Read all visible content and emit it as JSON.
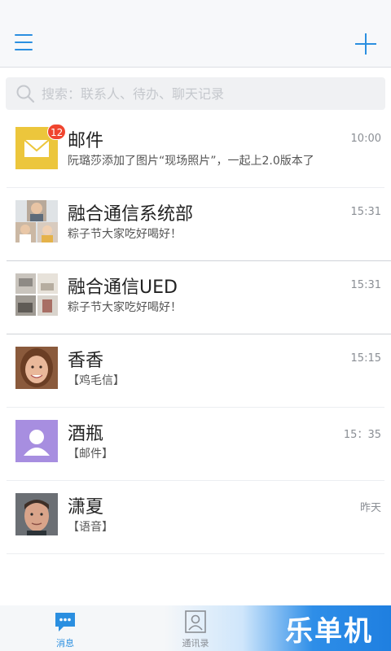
{
  "header": {
    "menu_icon": "hamburger-menu-icon",
    "add_icon": "plus-icon",
    "accent_color": "#2b8fe0"
  },
  "search": {
    "placeholder": "搜索：联系人、待办、聊天记录",
    "icon": "search-icon"
  },
  "conversations": [
    {
      "name": "邮件",
      "preview": "阮璐莎添加了图片“现场照片”，一起上2.0版本了",
      "time": "10:00",
      "badge": "12",
      "avatar": "mail-envelope-icon"
    },
    {
      "name": "融合通信系统部",
      "preview": "粽子节大家吃好喝好！",
      "time": "15:31",
      "avatar": "group-photo-collage"
    },
    {
      "name": "融合通信UED",
      "preview": "粽子节大家吃好喝好！",
      "time": "15:31",
      "avatar": "group-photo-collage"
    },
    {
      "name": "香香",
      "preview": "【鸡毛信】",
      "time": "15:15",
      "avatar": "woman-photo"
    },
    {
      "name": "酒瓶",
      "preview": "【邮件】",
      "time": "15：35",
      "avatar": "default-person-icon"
    },
    {
      "name": "潇夏",
      "preview": "【语音】",
      "time": "昨天",
      "avatar": "man-photo"
    }
  ],
  "tabbar": {
    "tabs": [
      {
        "label": "消息",
        "icon": "chat-bubble-icon",
        "active": true
      },
      {
        "label": "通讯录",
        "icon": "contacts-icon",
        "active": false
      }
    ],
    "watermark": "乐单机"
  }
}
